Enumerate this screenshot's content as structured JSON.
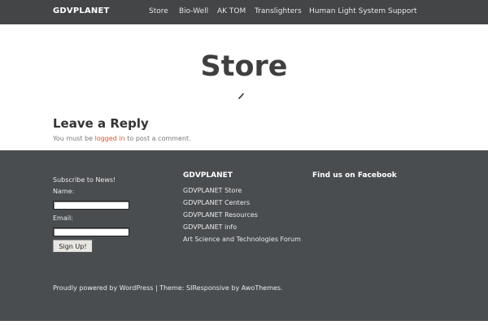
{
  "header": {
    "brand": "GDVPLANET",
    "nav": [
      "Store",
      "Bio-Well",
      "AK TOM",
      "Translighters",
      "Human Light System",
      "Support"
    ]
  },
  "main": {
    "title": "Store",
    "reply_heading": "Leave a Reply",
    "reply_prefix": "You must be ",
    "reply_link": "logged in",
    "reply_suffix": " to post a comment."
  },
  "footer": {
    "subscribe": {
      "title": "Subscribe to News!",
      "name_label": "Name:",
      "name_value": "",
      "email_label": "Email:",
      "email_value": "",
      "button": "Sign Up!"
    },
    "links": {
      "heading": "GDVPLANET",
      "items": [
        "GDVPLANET Store",
        "GDVPLANET Centers",
        "GDVPLANET Resources",
        "GDVPLANET info",
        "Art Science and Technologies Forum"
      ]
    },
    "facebook": {
      "heading": "Find us on Facebook"
    },
    "credit": "Proudly powered by WordPress | Theme: SIResponsive by AwoThemes."
  }
}
